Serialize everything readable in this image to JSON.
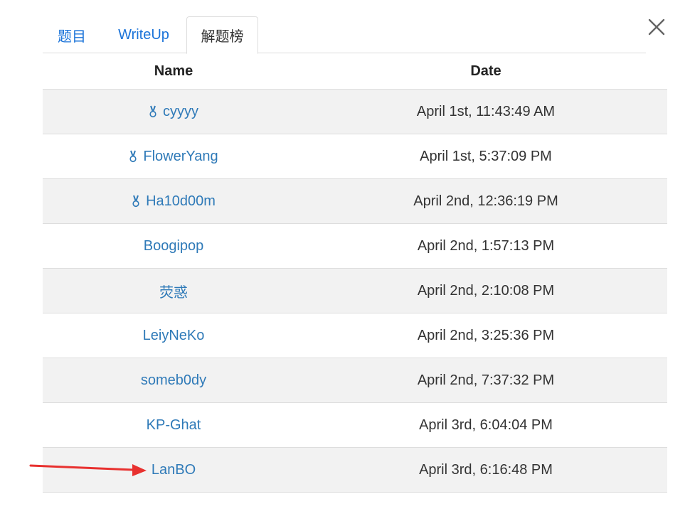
{
  "tabs": [
    {
      "label": "题目",
      "active": false
    },
    {
      "label": "WriteUp",
      "active": false
    },
    {
      "label": "解题榜",
      "active": true
    }
  ],
  "table": {
    "headers": {
      "name": "Name",
      "date": "Date"
    },
    "rows": [
      {
        "name": "cyyyy",
        "date": "April 1st, 11:43:49 AM",
        "medal": true
      },
      {
        "name": "FlowerYang",
        "date": "April 1st, 5:37:09 PM",
        "medal": true
      },
      {
        "name": "Ha10d00m",
        "date": "April 2nd, 12:36:19 PM",
        "medal": true
      },
      {
        "name": "Boogipop",
        "date": "April 2nd, 1:57:13 PM",
        "medal": false
      },
      {
        "name": "荧惑",
        "date": "April 2nd, 2:10:08 PM",
        "medal": false
      },
      {
        "name": "LeiyNeKo",
        "date": "April 2nd, 3:25:36 PM",
        "medal": false
      },
      {
        "name": "someb0dy",
        "date": "April 2nd, 7:37:32 PM",
        "medal": false
      },
      {
        "name": "KP-Ghat",
        "date": "April 3rd, 6:04:04 PM",
        "medal": false
      },
      {
        "name": "LanBO",
        "date": "April 3rd, 6:16:48 PM",
        "medal": false
      }
    ]
  },
  "colors": {
    "link": "#2f7ab8",
    "tab_link": "#1a73d9",
    "stripe": "#f2f2f2",
    "arrow": "#e8312f"
  },
  "icons": {
    "close": "close-icon",
    "medal": "medal-icon",
    "annotation": "red-arrow-icon"
  }
}
